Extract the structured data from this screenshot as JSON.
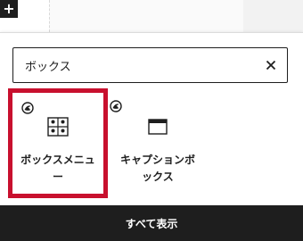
{
  "toolbar": {
    "add_block_symbol": "+"
  },
  "search": {
    "value": "ボックス",
    "clear_icon": "close-icon"
  },
  "results": [
    {
      "label": "ボックスメニュー",
      "icon": "grid-icon",
      "badge_icon": "plugin-badge-icon",
      "selected": true
    },
    {
      "label": "キャプションボックス",
      "icon": "window-icon",
      "badge_icon": "plugin-badge-icon",
      "selected": false
    }
  ],
  "footer": {
    "label": "すべて表示"
  },
  "colors": {
    "highlight": "#c8102e",
    "dark": "#1e1e1e"
  }
}
